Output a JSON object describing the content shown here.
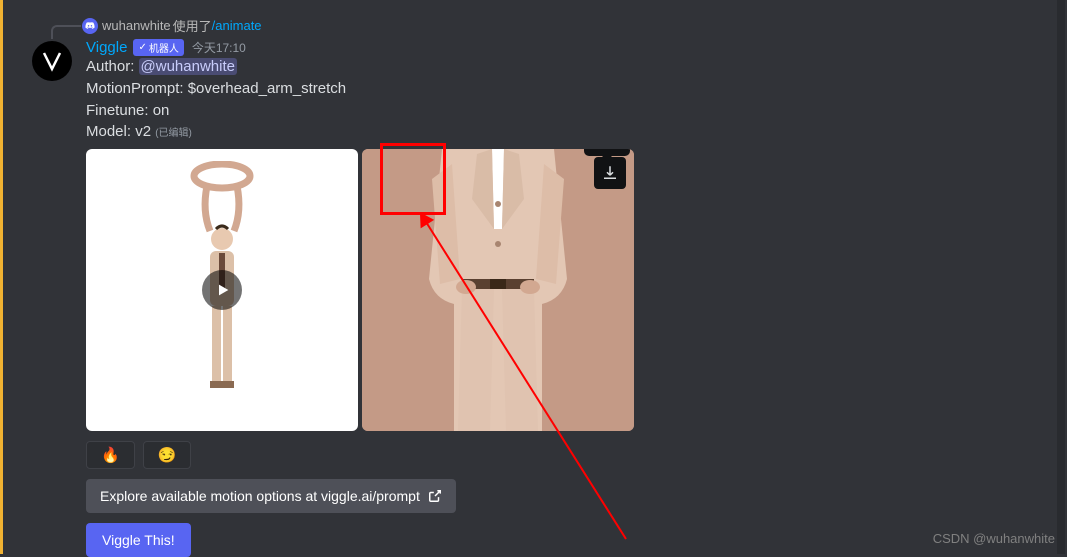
{
  "reply": {
    "user": "wuhanwhite",
    "action": "使用了",
    "command": "/animate"
  },
  "message": {
    "bot_name": "Viggle",
    "bot_tag_label": "机器人",
    "timestamp": "今天17:10",
    "author_label": "Author: ",
    "author_mention": "@wuhanwhite",
    "motion_prompt": "MotionPrompt: $overhead_arm_stretch",
    "finetune": "Finetune: on",
    "model": "Model: v2",
    "edited": "(已编辑)"
  },
  "tooltip": {
    "download": "下载"
  },
  "reactions": {
    "fire": "🔥",
    "thinking": "😏"
  },
  "buttons": {
    "explore": "Explore available motion options at viggle.ai/prompt",
    "viggle": "Viggle This!"
  },
  "watermark": "CSDN @wuhanwhite"
}
